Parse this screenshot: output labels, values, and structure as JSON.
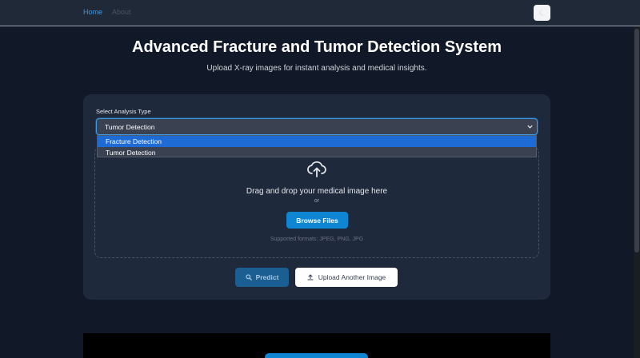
{
  "nav": {
    "home": "Home",
    "about": "About",
    "theme_icon": "moon-icon"
  },
  "header": {
    "title": "Advanced Fracture and Tumor Detection System",
    "subtitle": "Upload X-ray images for instant analysis and medical insights."
  },
  "analysis": {
    "label": "Select Analysis Type",
    "selected": "Tumor Detection",
    "options": [
      "Fracture Detection",
      "Tumor Detection"
    ],
    "highlighted_option": "Fracture Detection"
  },
  "upload": {
    "icon": "cloud-upload-icon",
    "drag_text": "Drag and drop your medical image here",
    "or_text": "or",
    "browse_label": "Browse Files",
    "formats": "Supported formats: JPEG, PNG, JPG"
  },
  "actions": {
    "predict_label": "Predict",
    "upload_another_label": "Upload Another Image"
  },
  "colors": {
    "background": "#111827",
    "card": "#1e293b",
    "accent": "#0e86d4",
    "highlight": "#1e6bd6"
  }
}
